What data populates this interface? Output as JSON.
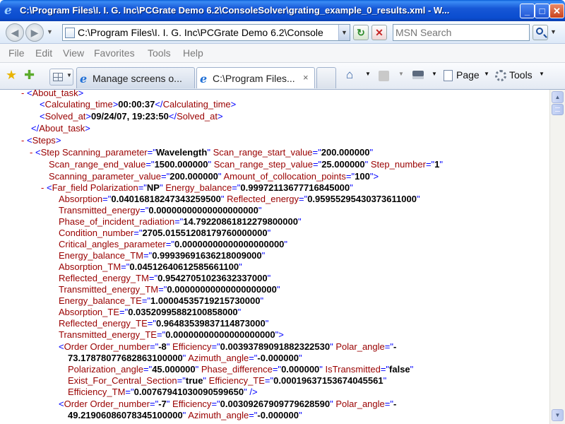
{
  "window": {
    "title": "C:\\Program Files\\I. I. G. Inc\\PCGrate Demo 6.2\\ConsoleSolver\\grating_example_0_results.xml - W...",
    "min": "_",
    "max": "□",
    "close": "✕"
  },
  "address": {
    "value": "C:\\Program Files\\I. I. G. Inc\\PCGrate Demo 6.2\\Console",
    "search_placeholder": "MSN Search"
  },
  "menu": [
    "File",
    "Edit",
    "View",
    "Favorites",
    "Tools",
    "Help"
  ],
  "tabs": [
    {
      "label": "Manage screens o..."
    },
    {
      "label": "C:\\Program Files..."
    }
  ],
  "tab_close": "×",
  "commands": {
    "page": "Page",
    "tools": "Tools"
  },
  "icons": {
    "ie": "e",
    "back": "◀",
    "forward": "▶",
    "refresh": "↻",
    "stop": "✕",
    "star": "★",
    "add_fav": "✚",
    "home": "⌂",
    "arrow": "▼"
  },
  "xml": {
    "about_task_open": "About_task",
    "calc_time_tag": "Calculating_time",
    "calc_time_val": "00:00:37",
    "solved_at_tag": "Solved_at",
    "solved_at_val": "09/24/07, 19:23:50",
    "about_task_close": "About_task",
    "steps_tag": "Steps",
    "step": {
      "tag": "Step",
      "scanning_parameter": "Wavelength",
      "scan_range_start_value": "200.000000",
      "scan_range_end_value": "1500.000000",
      "scan_range_step_value": "25.000000",
      "step_number": "1",
      "scanning_parameter_value": "200.000000",
      "amount_of_collocation_points": "100"
    },
    "far_field": {
      "tag": "Far_field",
      "polarization": "NP",
      "energy_balance": "0.99972113677716845000",
      "absorption": "0.04016818247343259500",
      "reflected_energy": "0.95955295430373611000",
      "transmitted_energy": "0.00000000000000000000",
      "phase_of_incident_radiation": "14.79220861812279800000",
      "condition_number": "2705.01551208179760000000",
      "critical_angles_parameter": "0.00000000000000000000",
      "energy_balance_tm": "0.99939691636218009000",
      "absorption_tm": "0.0451264061258566110​0",
      "reflected_energy_tm": "0.95427051023632337000",
      "transmitted_energy_tm": "0.00000000000000000000",
      "energy_balance_te": "1.00004535719215730000",
      "absorption_te": "0.03520995882100858000",
      "reflected_energy_te": "0.96483539837114873000",
      "transmitted_energy_te": "0.00000000000000000000"
    },
    "order1": {
      "tag": "Order",
      "order_number": "-8",
      "efficiency": "0.00393789091882322530",
      "polar_angle_a": "-",
      "polar_angle_b": "73.17878077682863100000",
      "azimuth_angle": "-0.000000",
      "polarization_angle": "45.000000",
      "phase_difference": "0.000000",
      "is_transmitted": "false",
      "exist_for_central_section": "true",
      "efficiency_te": "0.00019637153674045561",
      "efficiency_tm": "0.00767941030090599650"
    },
    "order2": {
      "tag": "Order",
      "order_number": "-7",
      "efficiency": "0.00309267909779628590",
      "polar_angle_a": "-",
      "polar_angle_b": "49.21906086078345100000",
      "azimuth_angle": "-0.000000"
    }
  }
}
